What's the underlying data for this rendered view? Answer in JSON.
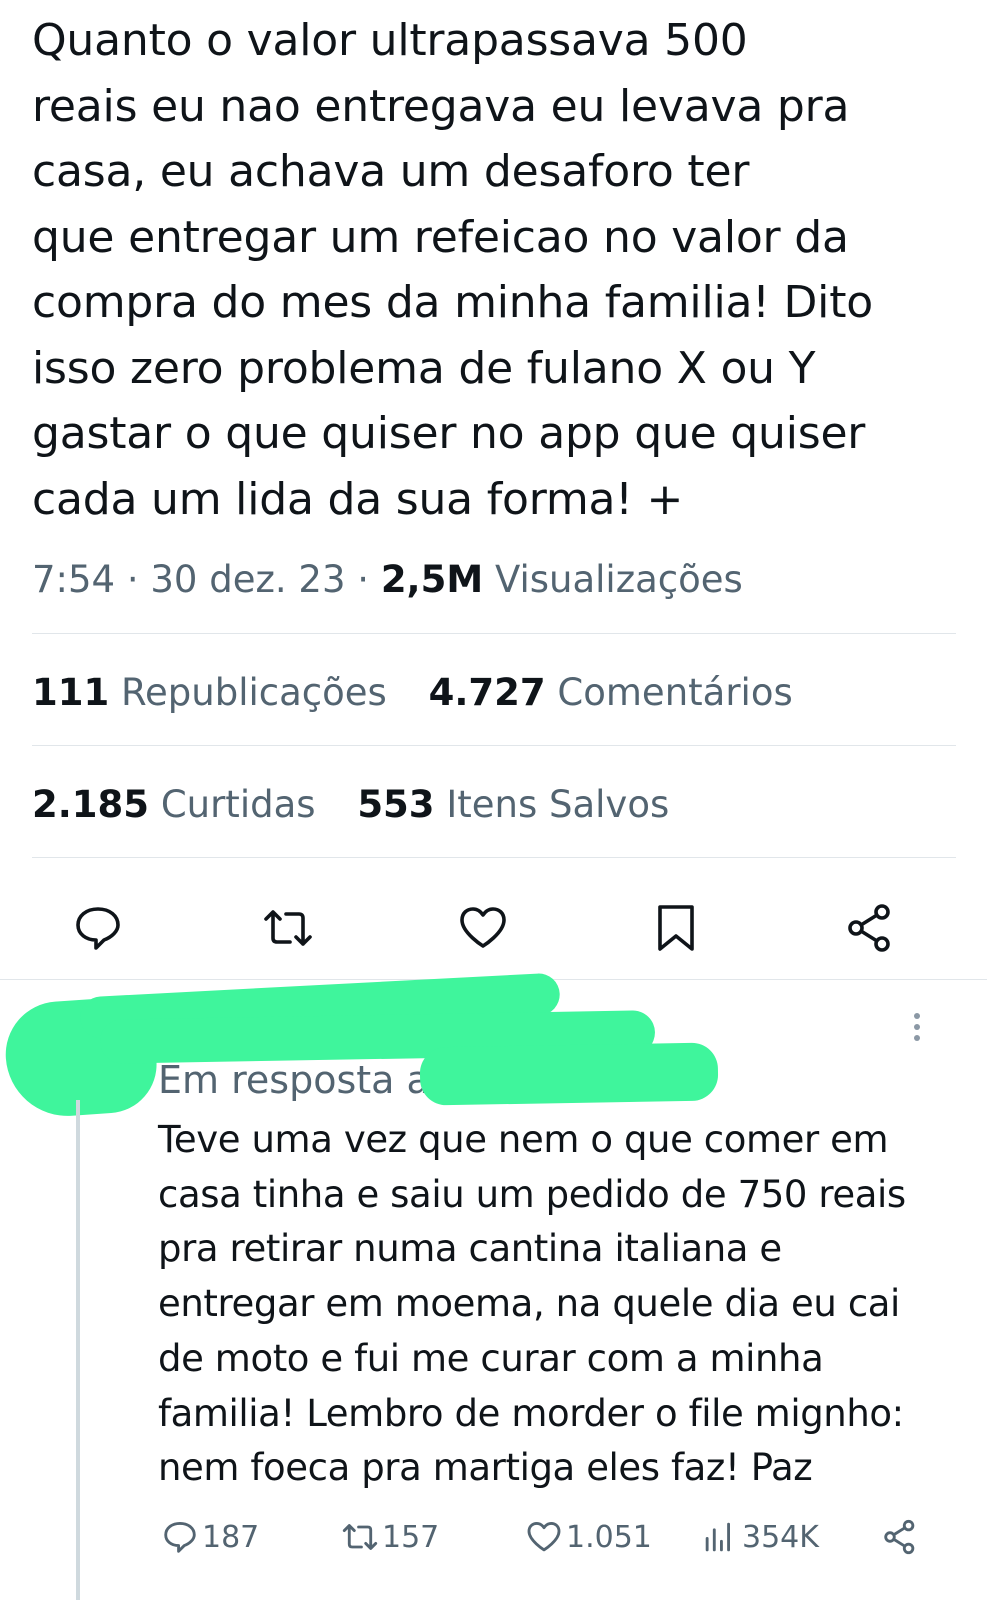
{
  "tweet": {
    "lines": [
      "Quanto o valor ultrapassava 500",
      "reais eu nao entregava eu levava pra",
      "casa, eu achava um desaforo ter",
      "que entregar um refeicao no valor da",
      "compra do mes da minha familia! Dito",
      "isso zero problema de fulano X ou Y",
      "gastar o que quiser no app que quiser",
      "cada um lida da sua forma! +"
    ],
    "time": "7:54",
    "date": "30 dez. 23",
    "views_count": "2,5M",
    "views_label": "Visualizações",
    "reposts_count": "111",
    "reposts_label": "Republicações",
    "comments_count": "4.727",
    "comments_label": "Comentários",
    "likes_count": "2.185",
    "likes_label": "Curtidas",
    "bookmarks_count": "553",
    "bookmarks_label": "Itens Salvos"
  },
  "actions": {
    "icons": [
      "comment-icon",
      "retweet-icon",
      "heart-icon",
      "bookmark-icon",
      "share-icon"
    ]
  },
  "reply": {
    "in_reply_to": "Em resposta a",
    "lines": [
      "Teve uma vez que nem o que comer em",
      "casa tinha e saiu um pedido de 750 reais",
      "pra retirar numa cantina italiana e",
      "entregar em moema, na quele dia eu cai",
      "de moto e fui me curar com a minha",
      "familia! Lembro de morder o file mignho:",
      "nem foeca pra martiga eles faz! Paz"
    ],
    "stats": {
      "comments": "187",
      "retweets": "157",
      "likes": "1.051",
      "views": "354K"
    }
  },
  "colors": {
    "text": "#0f1419",
    "secondary": "#536471",
    "divider": "#e1e6ea",
    "redaction": "#3ff59c"
  }
}
